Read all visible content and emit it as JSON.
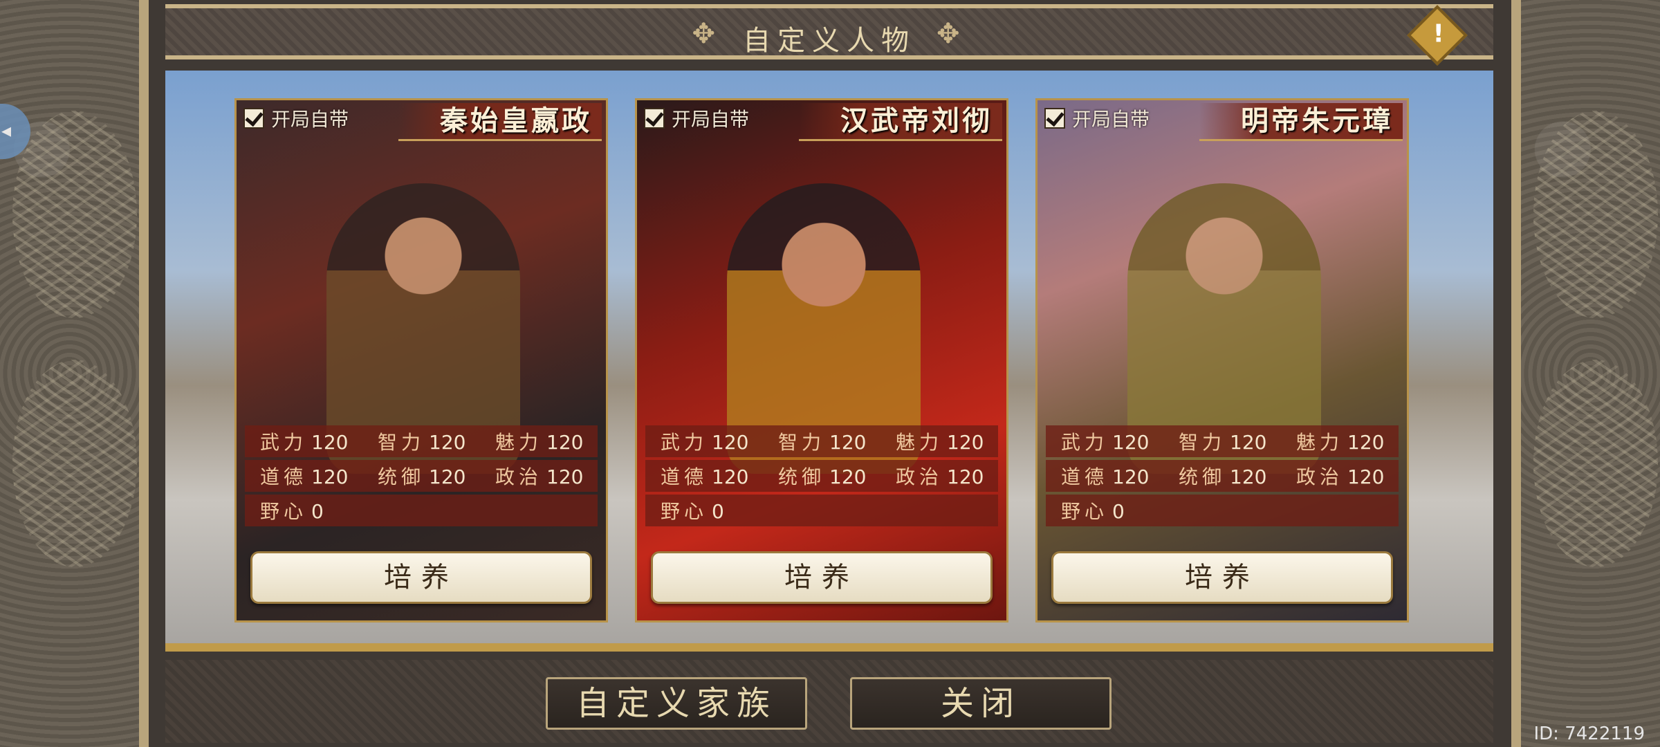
{
  "title": "自定义人物",
  "warning_icon": "exclamation-icon",
  "cards": [
    {
      "check_label": "开局自带",
      "name": "秦始皇嬴政",
      "stats": [
        [
          {
            "label": "武力",
            "value": "120"
          },
          {
            "label": "智力",
            "value": "120"
          },
          {
            "label": "魅力",
            "value": "120"
          }
        ],
        [
          {
            "label": "道德",
            "value": "120"
          },
          {
            "label": "统御",
            "value": "120"
          },
          {
            "label": "政治",
            "value": "120"
          }
        ],
        [
          {
            "label": "野心",
            "value": "0"
          }
        ]
      ],
      "button": "培养"
    },
    {
      "check_label": "开局自带",
      "name": "汉武帝刘彻",
      "stats": [
        [
          {
            "label": "武力",
            "value": "120"
          },
          {
            "label": "智力",
            "value": "120"
          },
          {
            "label": "魅力",
            "value": "120"
          }
        ],
        [
          {
            "label": "道德",
            "value": "120"
          },
          {
            "label": "统御",
            "value": "120"
          },
          {
            "label": "政治",
            "value": "120"
          }
        ],
        [
          {
            "label": "野心",
            "value": "0"
          }
        ]
      ],
      "button": "培养"
    },
    {
      "check_label": "开局自带",
      "name": "明帝朱元璋",
      "stats": [
        [
          {
            "label": "武力",
            "value": "120"
          },
          {
            "label": "智力",
            "value": "120"
          },
          {
            "label": "魅力",
            "value": "120"
          }
        ],
        [
          {
            "label": "道德",
            "value": "120"
          },
          {
            "label": "统御",
            "value": "120"
          },
          {
            "label": "政治",
            "value": "120"
          }
        ],
        [
          {
            "label": "野心",
            "value": "0"
          }
        ]
      ],
      "button": "培养"
    }
  ],
  "footer": {
    "custom_family": "自定义家族",
    "close": "关闭",
    "id_text": "ID: 7422119"
  }
}
